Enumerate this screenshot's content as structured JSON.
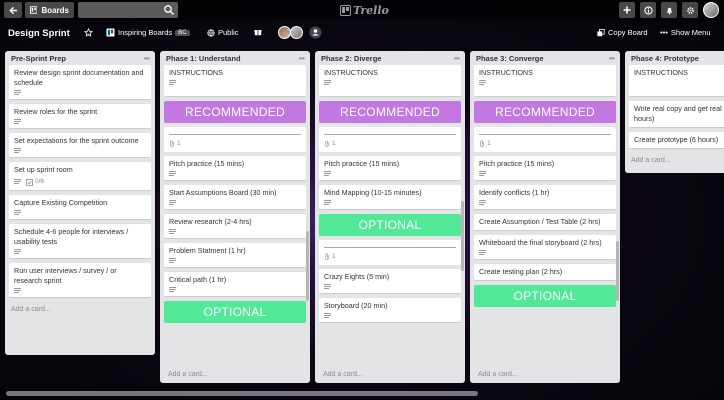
{
  "topbar": {
    "boards_label": "Boards",
    "search_value": "",
    "logo_text": "Trello"
  },
  "boardbar": {
    "title": "Design Sprint",
    "team_name": "Inspiring Boards",
    "team_badge": "BC",
    "visibility": "Public",
    "copy_board": "Copy Board",
    "show_menu": "Show Menu"
  },
  "add_card_label": "Add a card...",
  "lists": [
    {
      "name": "Pre-Sprint Prep",
      "cards": [
        {
          "title": "Review design sprint documentation and schedule",
          "desc": true
        },
        {
          "title": "Review roles for the sprint",
          "desc": true
        },
        {
          "title": "Set expectations for the sprint outcome",
          "desc": true
        },
        {
          "title": "Set up sprint room",
          "desc": true,
          "checklist": "0/6"
        },
        {
          "title": "Capture Existing Competition",
          "desc": true
        },
        {
          "title": "Schedule 4-6 people for interviews / usability tests",
          "desc": true
        },
        {
          "title": "Run user interviews / survey / or research sprint",
          "desc": true
        }
      ]
    },
    {
      "name": "Phase 1: Understand",
      "instructions": "INSTRUCTIONS",
      "recommended": "RECOMMENDED",
      "attach_count": "1",
      "cards": [
        {
          "title": "Pitch practice (15 mins)",
          "desc": true
        },
        {
          "title": "Start Assumptions Board (30 min)",
          "desc": true
        },
        {
          "title": "Review research (2-4 hrs)",
          "desc": true
        },
        {
          "title": "Problem Statment (1 hr)",
          "desc": true
        },
        {
          "title": "Critical path (1 hr)",
          "desc": true
        }
      ],
      "optional": "OPTIONAL"
    },
    {
      "name": "Phase 2: Diverge",
      "instructions": "INSTRUCTIONS",
      "recommended": "RECOMMENDED",
      "attach_count": "1",
      "cards_a": [
        {
          "title": "Pitch practice (15 mins)",
          "desc": true
        },
        {
          "title": "Mind Mapping (10-15 minutes)",
          "desc": true
        }
      ],
      "optional": "OPTIONAL",
      "attach_count_2": "1",
      "cards_b": [
        {
          "title": "Crazy Eights (5 min)",
          "desc": true
        },
        {
          "title": "Storyboard (20 min)",
          "desc": true
        }
      ]
    },
    {
      "name": "Phase 3: Converge",
      "instructions": "INSTRUCTIONS",
      "recommended": "RECOMMENDED",
      "attach_count": "1",
      "cards": [
        {
          "title": "Pitch practice (15 mins)",
          "desc": true
        },
        {
          "title": "Identify conflicts (1 hr)",
          "desc": true
        },
        {
          "title": "Create Assumption / Test Table (2 hrs)",
          "desc": false
        },
        {
          "title": "Whiteboard the final storyboard (2 hrs)",
          "desc": true
        },
        {
          "title": "Create testing plan (2 hrs)",
          "desc": false
        }
      ],
      "optional": "OPTIONAL"
    },
    {
      "name": "Phase 4: Prototype",
      "instructions": "INSTRUCTIONS",
      "cards": [
        {
          "title": "Write real copy and get real hours)",
          "desc": false
        },
        {
          "title": "Create prototype (6 hours)",
          "desc": false
        }
      ]
    }
  ],
  "colors": {
    "recommended": "#c377e0",
    "optional": "#51e898"
  }
}
